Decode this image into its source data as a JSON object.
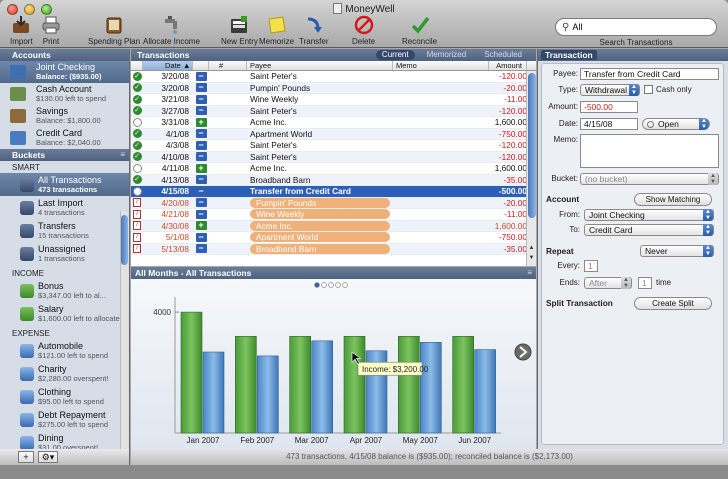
{
  "window": {
    "title": "MoneyWell"
  },
  "toolbar": {
    "import": "Import",
    "print": "Print",
    "spending_plan": "Spending Plan",
    "allocate_income": "Allocate Income",
    "new_entry": "New Entry",
    "memorize": "Memorize",
    "transfer": "Transfer",
    "delete": "Delete",
    "reconcile": "Reconcile",
    "search_value": "All",
    "search_label": "Search Transactions"
  },
  "sidebar": {
    "accounts_title": "Accounts",
    "accounts": [
      {
        "name": "Joint Checking",
        "sub": "Balance: ($935.00)",
        "color": "#3f6fb0"
      },
      {
        "name": "Cash Account",
        "sub": "$130.00 left to spend",
        "color": "#6b8f4a"
      },
      {
        "name": "Savings",
        "sub": "Balance: $1,800.00",
        "color": "#8c6a3c"
      },
      {
        "name": "Credit Card",
        "sub": "Balance: $2,040.00",
        "color": "#4a7ac0"
      }
    ],
    "buckets_title": "Buckets",
    "smart_label": "SMART",
    "smart": [
      {
        "name": "All Transactions",
        "sub": "473 transactions"
      },
      {
        "name": "Last Import",
        "sub": "4 transactions"
      },
      {
        "name": "Transfers",
        "sub": "15 transactions"
      },
      {
        "name": "Unassigned",
        "sub": "1 transactions"
      }
    ],
    "income_label": "INCOME",
    "income": [
      {
        "name": "Bonus",
        "sub": "$3,347.00 left to al..."
      },
      {
        "name": "Salary",
        "sub": "$1,600.00 left to allocate"
      }
    ],
    "expense_label": "EXPENSE",
    "expense": [
      {
        "name": "Automobile",
        "sub": "$121.00 left to spend"
      },
      {
        "name": "Charity",
        "sub": "$2,280.00 overspent!"
      },
      {
        "name": "Clothing",
        "sub": "$95.00 left to spend"
      },
      {
        "name": "Debt Repayment",
        "sub": "$275.00 left to spend"
      },
      {
        "name": "Dining",
        "sub": "$31.00 overspent!"
      },
      {
        "name": "Education",
        "sub": "$40.00 left to spend"
      }
    ],
    "add_button": "+",
    "action_button": "⚙▾"
  },
  "transactions": {
    "title": "Transactions",
    "tabs": [
      "Current",
      "Memorized",
      "Scheduled"
    ],
    "columns": {
      "date": "Date",
      "num": "#",
      "payee": "Payee",
      "memo": "Memo",
      "amount": "Amount"
    },
    "rows": [
      {
        "status": "cleared",
        "date": "3/20/08",
        "type": "out",
        "payee": "Saint Peter's",
        "amount": "-120.00",
        "neg": true,
        "future": false
      },
      {
        "status": "cleared",
        "date": "3/20/08",
        "type": "out",
        "payee": "Pumpin' Pounds",
        "amount": "-20.00",
        "neg": true,
        "future": false
      },
      {
        "status": "cleared",
        "date": "3/21/08",
        "type": "out",
        "payee": "Wine Weekly",
        "amount": "-11.00",
        "neg": true,
        "future": false
      },
      {
        "status": "cleared",
        "date": "3/27/08",
        "type": "out",
        "payee": "Saint Peter's",
        "amount": "-120.00",
        "neg": true,
        "future": false
      },
      {
        "status": "open",
        "date": "3/31/08",
        "type": "in",
        "payee": "Acme Inc.",
        "amount": "1,600.00",
        "neg": false,
        "future": false
      },
      {
        "status": "cleared",
        "date": "4/1/08",
        "type": "out",
        "payee": "Apartment World",
        "amount": "-750.00",
        "neg": true,
        "future": false
      },
      {
        "status": "cleared",
        "date": "4/3/08",
        "type": "out",
        "payee": "Saint Peter's",
        "amount": "-120.00",
        "neg": true,
        "future": false
      },
      {
        "status": "cleared",
        "date": "4/10/08",
        "type": "out",
        "payee": "Saint Peter's",
        "amount": "-120.00",
        "neg": true,
        "future": false
      },
      {
        "status": "open",
        "date": "4/11/08",
        "type": "in",
        "payee": "Acme Inc.",
        "amount": "1,600.00",
        "neg": false,
        "future": false
      },
      {
        "status": "cleared",
        "date": "4/13/08",
        "type": "out",
        "payee": "Broadband Barn",
        "amount": "-35.00",
        "neg": true,
        "future": false
      },
      {
        "status": "open",
        "date": "4/15/08",
        "type": "out",
        "payee": "Transfer from Credit Card",
        "amount": "-500.00",
        "neg": true,
        "future": false,
        "selected": true
      },
      {
        "status": "scheduled",
        "date": "4/20/08",
        "type": "out",
        "payee": "Pumpin' Pounds",
        "amount": "-20.00",
        "neg": true,
        "future": true
      },
      {
        "status": "scheduled",
        "date": "4/21/08",
        "type": "out",
        "payee": "Wine Weekly",
        "amount": "-11.00",
        "neg": true,
        "future": true
      },
      {
        "status": "scheduled",
        "date": "4/30/08",
        "type": "in",
        "payee": "Acme Inc.",
        "amount": "1,600.00",
        "neg": false,
        "future": true
      },
      {
        "status": "scheduled",
        "date": "5/1/08",
        "type": "out",
        "payee": "Apartment World",
        "amount": "-750.00",
        "neg": true,
        "future": true
      },
      {
        "status": "scheduled",
        "date": "5/13/08",
        "type": "out",
        "payee": "Broadband Barn",
        "amount": "-35.00",
        "neg": true,
        "future": true
      }
    ]
  },
  "chart": {
    "title": "All Months - All Transactions",
    "tooltip": "Income:   $3,200.00"
  },
  "chart_data": {
    "type": "bar",
    "categories": [
      "Jan 2007",
      "Feb 2007",
      "Mar 2007",
      "Apr 2007",
      "May 2007",
      "Jun 2007"
    ],
    "series": [
      {
        "values": [
          4000,
          3200,
          3200,
          3200,
          3200,
          3200
        ],
        "color": "#5aa84a"
      },
      {
        "values": [
          2680,
          2550,
          3050,
          2720,
          3000,
          2760
        ],
        "color": "#5a9ad6"
      }
    ],
    "ytick": 4000,
    "ylim": [
      0,
      4500
    ],
    "grid": false
  },
  "status_bar": {
    "text": "473 transactions, 4/15/08 balance is ($935.00); reconciled balance is ($2,173.00)"
  },
  "details": {
    "panel_title": "Transaction",
    "payee_label": "Payee:",
    "payee_value": "Transfer from Credit Card",
    "type_label": "Type:",
    "type_value": "Withdrawal",
    "cash_only_label": "Cash only",
    "amount_label": "Amount:",
    "amount_value": "-500.00",
    "date_label": "Date:",
    "date_value": "4/15/08",
    "status_value": "Open",
    "memo_label": "Memo:",
    "bucket_label": "Bucket:",
    "bucket_value": "(no bucket)",
    "account_section": "Account",
    "show_matching": "Show Matching",
    "from_label": "From:",
    "from_value": "Joint Checking",
    "to_label": "To:",
    "to_value": "Credit Card",
    "repeat_section": "Repeat",
    "repeat_value": "Never",
    "every_label": "Every:",
    "every_value": "1",
    "ends_label": "Ends:",
    "ends_value": "After",
    "ends_count": "1",
    "time_label": "time",
    "split_section": "Split Transaction",
    "create_split": "Create Split"
  }
}
